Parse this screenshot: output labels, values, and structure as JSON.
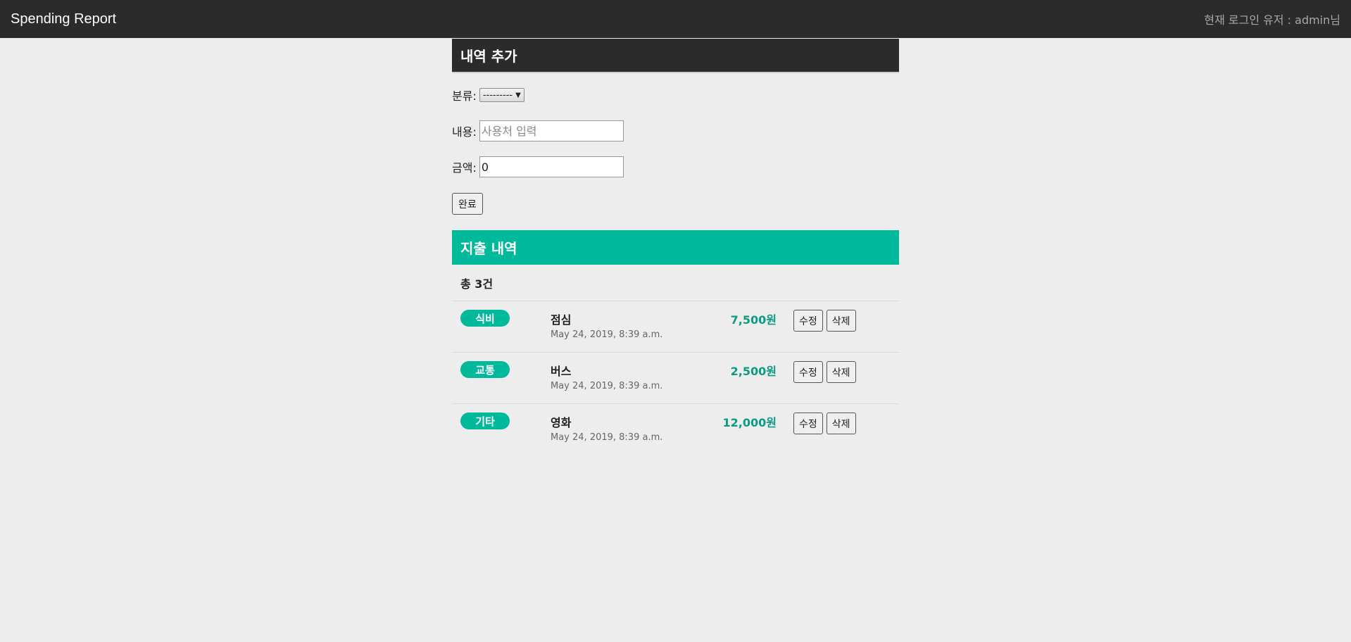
{
  "header": {
    "brand": "Spending Report",
    "user_info": "현재 로그인 유저 : admin님"
  },
  "form": {
    "title": "내역 추가",
    "category_label": "분류:",
    "category_selected": "---------",
    "content_label": "내용:",
    "content_placeholder": "사용처 입력",
    "amount_label": "금액:",
    "amount_value": "0",
    "submit_label": "완료"
  },
  "list": {
    "title": "지출 내역",
    "total": "총 3건",
    "items": [
      {
        "category": "식비",
        "name": "점심",
        "amount": "7,500원",
        "date": "May 24, 2019, 8:39 a.m.",
        "edit_label": "수정",
        "delete_label": "삭제"
      },
      {
        "category": "교통",
        "name": "버스",
        "amount": "2,500원",
        "date": "May 24, 2019, 8:39 a.m.",
        "edit_label": "수정",
        "delete_label": "삭제"
      },
      {
        "category": "기타",
        "name": "영화",
        "amount": "12,000원",
        "date": "May 24, 2019, 8:39 a.m.",
        "edit_label": "수정",
        "delete_label": "삭제"
      }
    ]
  },
  "colors": {
    "header_bg": "#2b2b2b",
    "accent": "#00b99b",
    "amount_text": "#0a9b82",
    "page_bg": "#ededed"
  }
}
